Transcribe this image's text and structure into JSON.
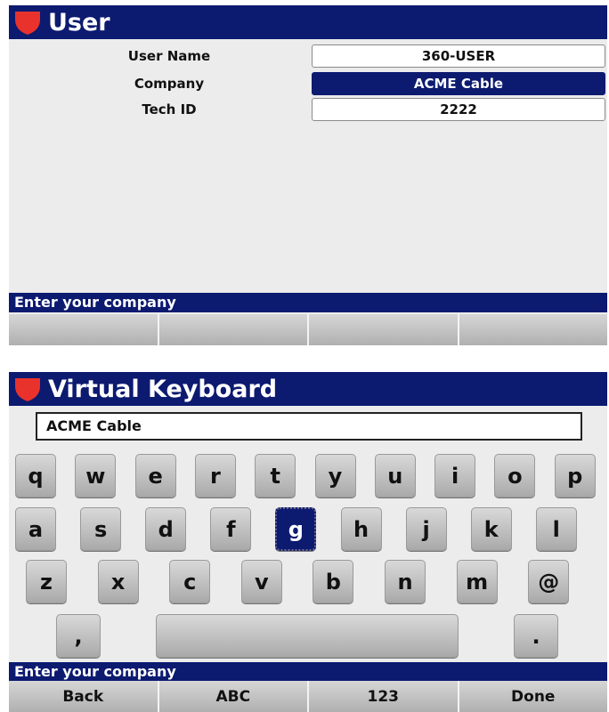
{
  "user_screen": {
    "title": "User",
    "fields": [
      {
        "label": "User Name",
        "value": "360-USER",
        "selected": false
      },
      {
        "label": "Company",
        "value": "ACME Cable",
        "selected": true
      },
      {
        "label": "Tech ID",
        "value": "2222",
        "selected": false
      }
    ],
    "hint": "Enter your company",
    "softkeys": [
      "",
      "",
      "",
      ""
    ]
  },
  "keyboard_screen": {
    "title": "Virtual Keyboard",
    "input_value": "ACME Cable",
    "rows": [
      [
        "q",
        "w",
        "e",
        "r",
        "t",
        "y",
        "u",
        "i",
        "o",
        "p"
      ],
      [
        "a",
        "s",
        "d",
        "f",
        "g",
        "h",
        "j",
        "k",
        "l"
      ],
      [
        "z",
        "x",
        "c",
        "v",
        "b",
        "n",
        "m",
        "@"
      ],
      [
        ",",
        "space",
        "."
      ]
    ],
    "selected_key": "g",
    "hint": "Enter your company",
    "softkeys": [
      "Back",
      "ABC",
      "123",
      "Done"
    ]
  },
  "colors": {
    "title_bar": "#0c1a70",
    "shield": "#e8322b",
    "screen_bg": "#ececec"
  },
  "icons": {
    "logo": "shield-icon"
  }
}
